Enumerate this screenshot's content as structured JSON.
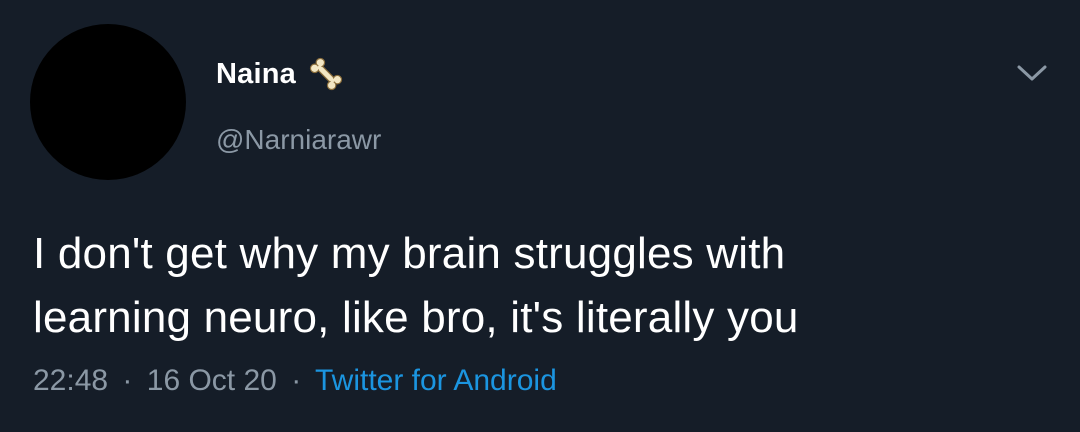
{
  "user": {
    "display_name": "Naina",
    "emoji": "bone-emoji",
    "handle": "@Narniarawr"
  },
  "tweet": {
    "lines": [
      "I don't get why my brain struggles with",
      "learning neuro, like bro, it's literally you"
    ],
    "time": "22:48",
    "separator": "·",
    "date": "16 Oct 20",
    "source": "Twitter for Android"
  },
  "colors": {
    "background": "#151d28",
    "primary_text": "#ffffff",
    "secondary_text": "#8b98a5",
    "link": "#1b95e0"
  },
  "icons": {
    "menu": "chevron-down-icon"
  }
}
